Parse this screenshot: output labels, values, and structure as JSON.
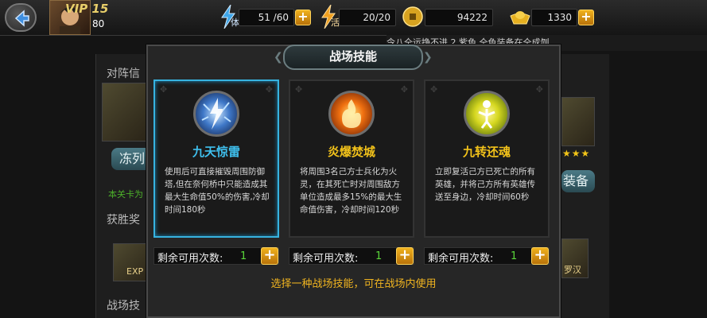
{
  "header": {
    "vip": "VIP 15",
    "level": "80",
    "stamina": {
      "label": "体",
      "value": "51 /60"
    },
    "vitality": {
      "label": "活",
      "value": "20/20"
    },
    "coins": "94222",
    "gold": "1330",
    "ticker": "令八仝运挣不进 2 紫色 仝色装备在仝成刎"
  },
  "background": {
    "panel_title": "对阵信",
    "freeze_button": "冻列",
    "green_note": "本关卡为",
    "reward_label": "获胜奖",
    "exp_label": "EXP",
    "skill_label": "战场技",
    "equip_button": "装备",
    "hero_name": "罗汉"
  },
  "dialog": {
    "title": "战场技能",
    "hint": "选择一种战场技能，可在战场内使用",
    "skills": [
      {
        "name": "九天惊雷",
        "name_color": "#3fc0ee",
        "icon": "lightning-orb-icon",
        "desc": "使用后可直接摧毁周围防御塔,但在奈何桥中只能造成其最大生命值50%的伤害,冷却时间180秒",
        "remaining_label": "剩余可用次数:",
        "remaining": "1"
      },
      {
        "name": "炎爆焚城",
        "name_color": "#f2c21a",
        "icon": "fire-orb-icon",
        "desc": "将周围3名己方士兵化为火灵，在其死亡时对周围敌方单位造成最多15%的最大生命值伤害，冷却时间120秒",
        "remaining_label": "剩余可用次数:",
        "remaining": "1"
      },
      {
        "name": "九转还魂",
        "name_color": "#f2c21a",
        "icon": "revive-orb-icon",
        "desc": "立即复活己方已死亡的所有英雄，并将己方所有英雄传送至身边，冷却时间60秒",
        "remaining_label": "剩余可用次数:",
        "remaining": "1"
      }
    ]
  }
}
